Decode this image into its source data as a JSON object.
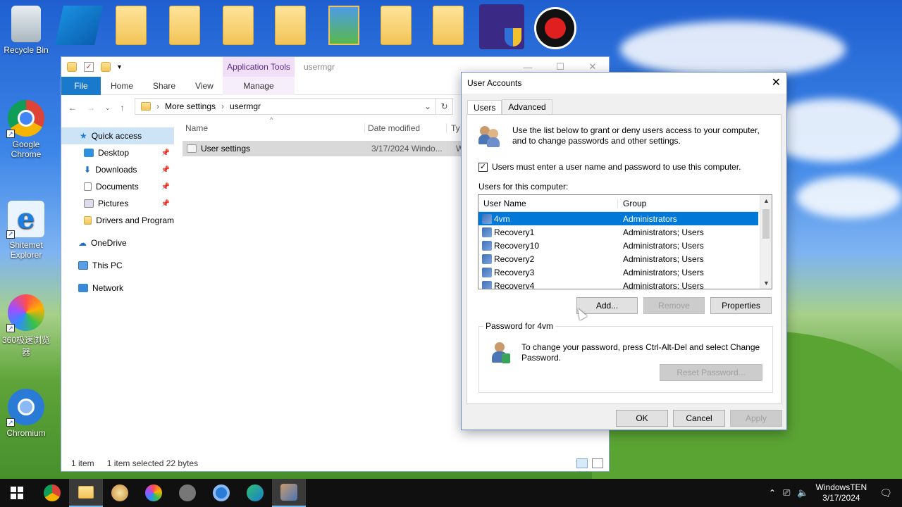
{
  "desktop": {
    "icons": [
      {
        "label": "Recycle Bin"
      },
      {
        "label": "Google Chrome"
      },
      {
        "label": "Shitemet Explorer"
      },
      {
        "label": "360极速浏览器"
      },
      {
        "label": "Chromium"
      }
    ]
  },
  "explorer": {
    "title": "usermgr",
    "app_tools": "Application Tools",
    "ribbon": {
      "file": "File",
      "home": "Home",
      "share": "Share",
      "view": "View",
      "manage": "Manage"
    },
    "breadcrumb": [
      "More settings",
      "usermgr"
    ],
    "nav": {
      "quick_access": "Quick access",
      "desktop": "Desktop",
      "downloads": "Downloads",
      "documents": "Documents",
      "pictures": "Pictures",
      "drivers": "Drivers and Program",
      "onedrive": "OneDrive",
      "this_pc": "This PC",
      "network": "Network"
    },
    "columns": {
      "name": "Name",
      "date": "Date modified",
      "type": "Ty"
    },
    "file": {
      "name": "User settings",
      "date": "3/17/2024 Windo...",
      "type": "W"
    },
    "status": {
      "count": "1 item",
      "selected": "1 item selected  22 bytes"
    }
  },
  "dialog": {
    "title": "User Accounts",
    "tabs": {
      "users": "Users",
      "advanced": "Advanced"
    },
    "intro": "Use the list below to grant or deny users access to your computer, and to change passwords and other settings.",
    "must_enter_label": "Users must enter a user name and password to use this computer.",
    "must_enter_checked": true,
    "users_label": "Users for this computer:",
    "list_headers": {
      "name": "User Name",
      "group": "Group"
    },
    "users": [
      {
        "name": "4vm",
        "group": "Administrators"
      },
      {
        "name": "Recovery1",
        "group": "Administrators; Users"
      },
      {
        "name": "Recovery10",
        "group": "Administrators; Users"
      },
      {
        "name": "Recovery2",
        "group": "Administrators; Users"
      },
      {
        "name": "Recovery3",
        "group": "Administrators; Users"
      },
      {
        "name": "Recovery4",
        "group": "Administrators; Users"
      }
    ],
    "buttons": {
      "add": "Add...",
      "remove": "Remove",
      "properties": "Properties"
    },
    "password_group": "Password for 4vm",
    "password_text": "To change your password, press Ctrl-Alt-Del and select Change Password.",
    "reset": "Reset Password...",
    "ok": "OK",
    "cancel": "Cancel",
    "apply": "Apply"
  },
  "taskbar": {
    "user": "WindowsTEN",
    "date": "3/17/2024"
  }
}
